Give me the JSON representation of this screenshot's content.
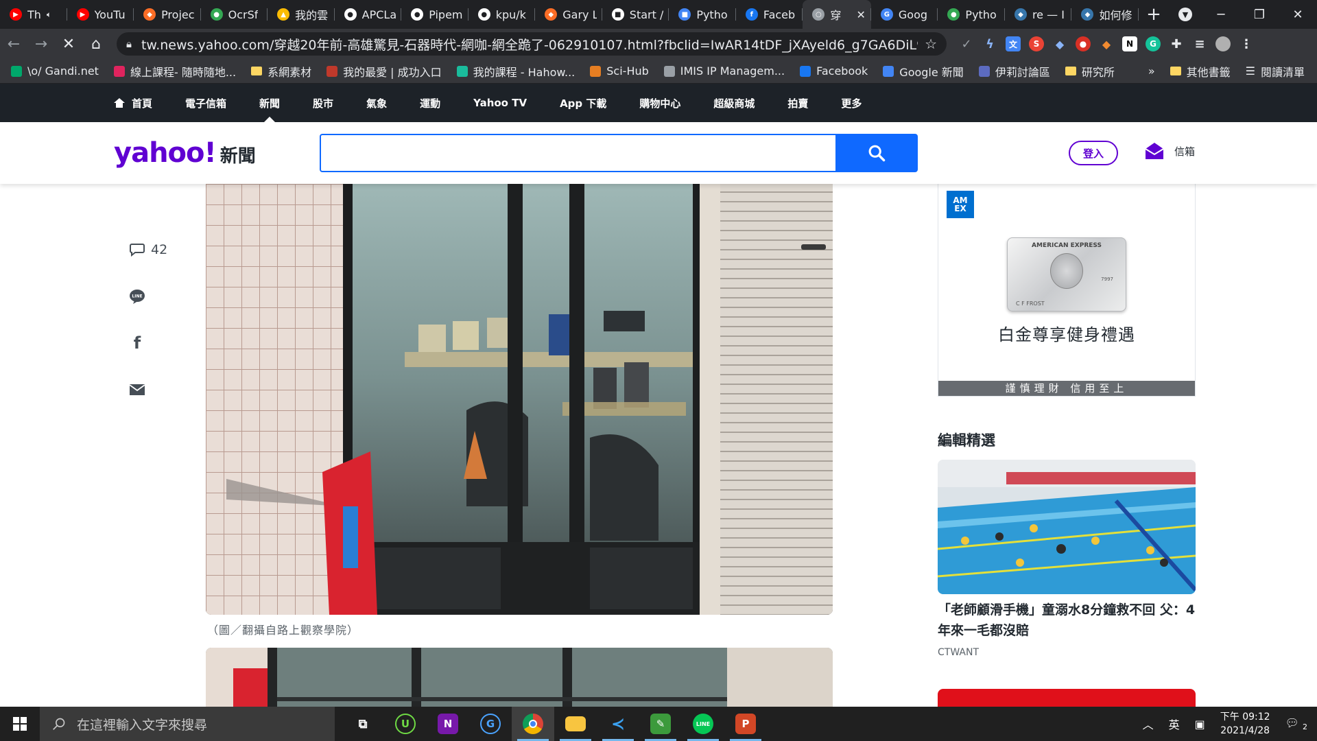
{
  "browser": {
    "tabs": [
      {
        "title": "Th",
        "color": "#ff0000",
        "glyph": "▶",
        "audio": true
      },
      {
        "title": "YouTu",
        "color": "#ff0000",
        "glyph": "▶"
      },
      {
        "title": "Projec",
        "color": "#fc6d26",
        "glyph": "◆"
      },
      {
        "title": "OcrSf",
        "color": "#34a853",
        "glyph": "●"
      },
      {
        "title": "我的雲",
        "color": "#fbbc04",
        "glyph": "▲"
      },
      {
        "title": "APCLa",
        "color": "#ffffff",
        "glyph": "●"
      },
      {
        "title": "Pipem",
        "color": "#ffffff",
        "glyph": "●"
      },
      {
        "title": "kpu/k",
        "color": "#ffffff",
        "glyph": "●"
      },
      {
        "title": "Gary L",
        "color": "#fc6d26",
        "glyph": "◆"
      },
      {
        "title": "Start /",
        "color": "#ffffff",
        "glyph": "■"
      },
      {
        "title": "Pytho",
        "color": "#4285f4",
        "glyph": "■"
      },
      {
        "title": "Faceb",
        "color": "#1877f2",
        "glyph": "f"
      },
      {
        "title": "穿",
        "color": "#9aa0a6",
        "glyph": "○",
        "active": true
      },
      {
        "title": "Goog",
        "color": "#4285f4",
        "glyph": "G"
      },
      {
        "title": "Pytho",
        "color": "#34a853",
        "glyph": "●"
      },
      {
        "title": "re — I",
        "color": "#3776ab",
        "glyph": "◆"
      },
      {
        "title": "如何修",
        "color": "#3776ab",
        "glyph": "◆"
      }
    ],
    "new_tab": "+",
    "url": "tw.news.yahoo.com/穿越20年前-高雄驚見-石器時代-網咖-網全跪了-062910107.html?fbclid=IwAR14tDF_jXAyeld6_g7GA6DiL9QLxHm8N...",
    "bookmarks": [
      {
        "label": "\\o/ Gandi.net",
        "color": "#00a86b"
      },
      {
        "label": "線上課程- 隨時隨地...",
        "color": "#e0245e"
      },
      {
        "label": "系網素材",
        "folder": true
      },
      {
        "label": "我的最愛 | 成功入口",
        "color": "#c0392b"
      },
      {
        "label": "我的課程 - Hahow...",
        "color": "#1abc9c"
      },
      {
        "label": "Sci-Hub",
        "color": "#e67e22"
      },
      {
        "label": "IMIS IP Managem...",
        "color": "#9aa0a6"
      },
      {
        "label": "Facebook",
        "color": "#1877f2"
      },
      {
        "label": "Google 新聞",
        "color": "#4285f4"
      },
      {
        "label": "伊莉討論區",
        "color": "#5c6bc0"
      },
      {
        "label": "研究所",
        "folder": true
      }
    ],
    "bookmarks_more": "»",
    "other_bookmarks": "其他書籤",
    "reading_list": "閱讀清單"
  },
  "yahoo": {
    "nav": [
      "首頁",
      "電子信箱",
      "新聞",
      "股市",
      "氣象",
      "運動",
      "Yahoo TV",
      "App 下載",
      "購物中心",
      "超級商城",
      "拍賣",
      "更多"
    ],
    "active_nav": 2,
    "logo": "yahoo!",
    "logo_sub": "新聞",
    "search_value": "",
    "login_label": "登入",
    "mail_label": "信箱",
    "comment_count": "42"
  },
  "article": {
    "caption": "（圖／翻攝自路上觀察學院）"
  },
  "sidebar": {
    "ad_brand": "AM EX",
    "ad_card_name": "AMERICAN EXPRESS",
    "ad_card_holder": "C F FROST",
    "ad_card_num": "7997",
    "ad_headline": "白金尊享健身禮遇",
    "ad_footer": "謹慎理財 信用至上",
    "editor_picks_title": "編輯精選",
    "story_title": "「老師顧滑手機」童溺水8分鐘救不回 父：4年來一毛都沒賠",
    "story_source": "CTWANT"
  },
  "taskbar": {
    "search_placeholder": "在這裡輸入文字來搜尋",
    "ime": "英",
    "time": "下午 09:12",
    "date": "2021/4/28",
    "notifications": "2"
  }
}
